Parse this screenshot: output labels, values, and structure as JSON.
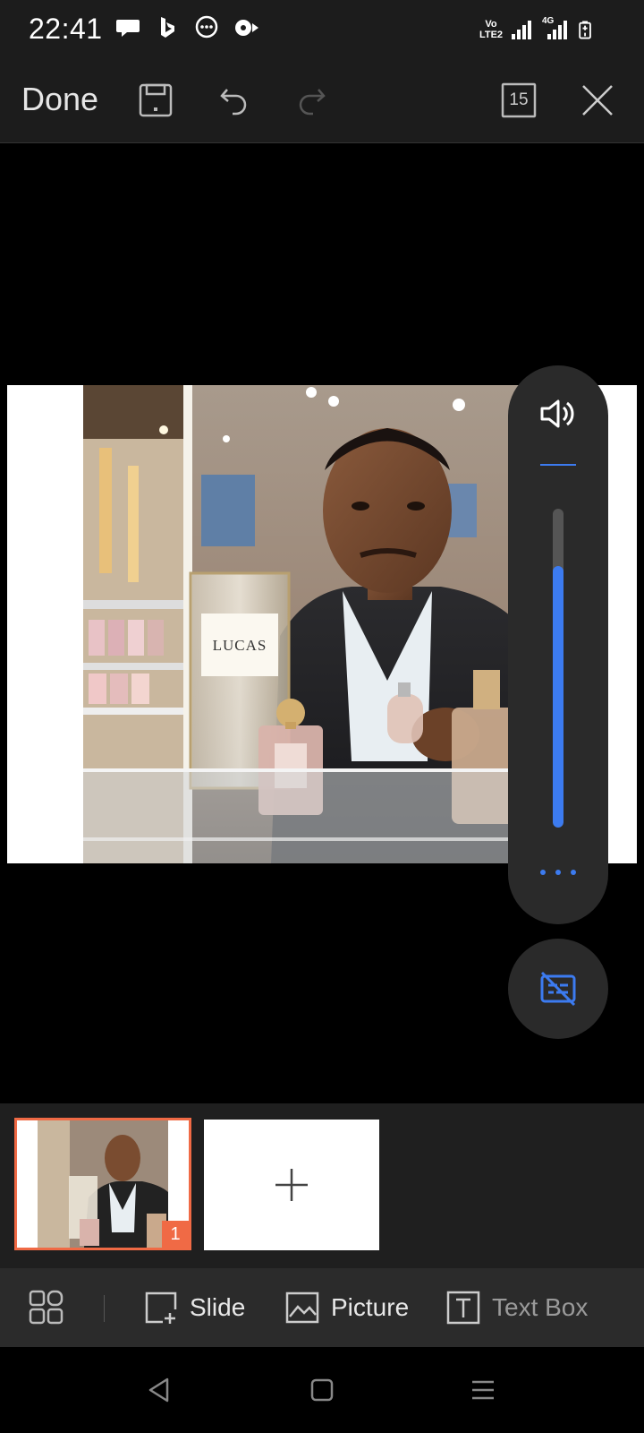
{
  "status_bar": {
    "time": "22:41",
    "network_label": "Vo LTE2",
    "network_type": "4G"
  },
  "toolbar": {
    "done_label": "Done",
    "page_count": "15"
  },
  "slide": {
    "product_label": "LUCAS"
  },
  "volume": {
    "level": 0.82
  },
  "thumbnails": {
    "items": [
      {
        "number": "1"
      }
    ]
  },
  "actions": {
    "slide_label": "Slide",
    "picture_label": "Picture",
    "textbox_label": "Text Box"
  },
  "colors": {
    "accent": "#3c7bf0",
    "selection": "#f06a45",
    "bar_bg": "#1c1c1c"
  }
}
